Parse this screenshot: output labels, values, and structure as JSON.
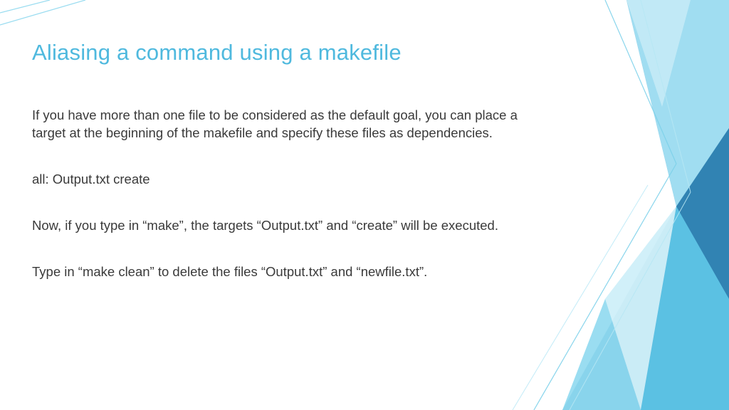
{
  "slide": {
    "title": "Aliasing a command using  a makefile",
    "paragraphs": [
      "If you have more than one file to be considered as the default goal, you can place a target at the beginning of the makefile and specify these files as dependencies.",
      "all: Output.txt create",
      "Now, if you type in “make”, the targets “Output.txt” and “create” will be executed.",
      "Type in “make clean” to delete the files “Output.txt” and “newfile.txt”."
    ]
  }
}
